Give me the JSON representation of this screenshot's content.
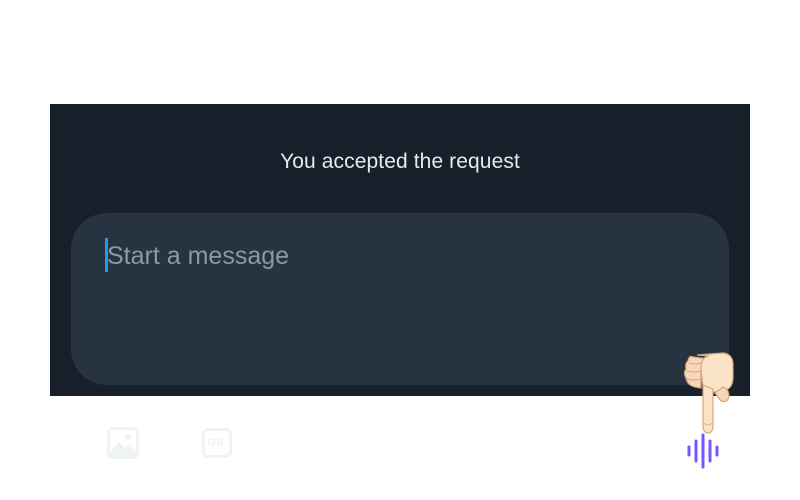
{
  "conversation": {
    "notice": "You accepted the request"
  },
  "composer": {
    "placeholder": "Start a message",
    "value": "",
    "toolbar": {
      "image_icon": "image-icon",
      "gif_label": "GIF",
      "voice_icon": "voice-waveform-icon"
    },
    "pointer_icon": "pointing-down-hand-emoji"
  },
  "colors": {
    "panel_bg": "#17202a",
    "composer_bg": "#273340",
    "caret": "#1d9bf0",
    "voice_accent": "#7856ff",
    "placeholder": "#8b98a5"
  }
}
